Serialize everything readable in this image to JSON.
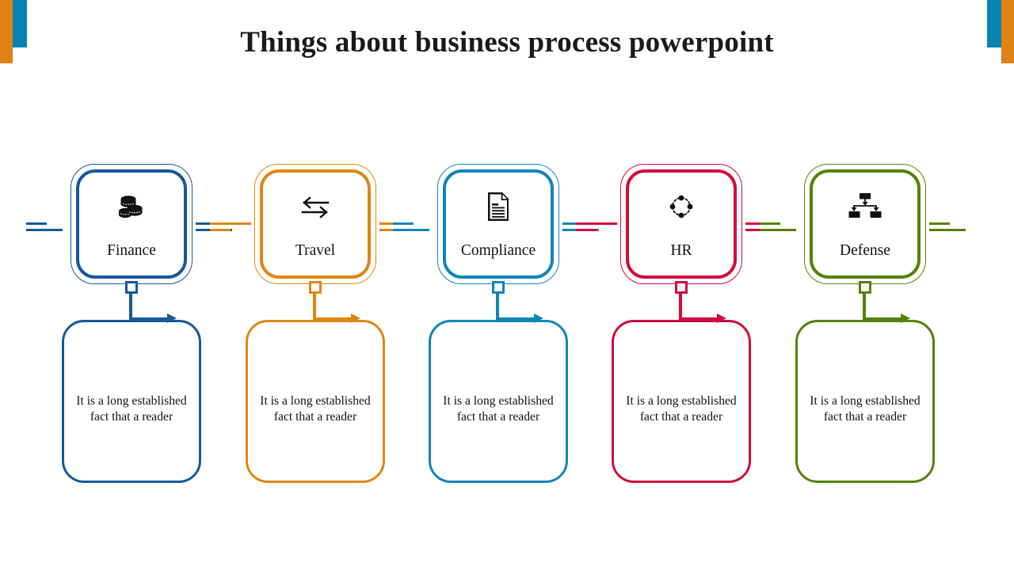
{
  "title": "Things about business process powerpoint",
  "decor": {
    "top_left_outer_color": "#DF8114",
    "top_left_inner_color": "#0682B4",
    "top_right_inner_color": "#0682B4",
    "top_right_outer_color": "#DF8114"
  },
  "columns": [
    {
      "label": "Finance",
      "icon": "coins-icon",
      "color": "#14599B",
      "body_text": "It is a long established fact that a reader"
    },
    {
      "label": "Travel",
      "icon": "exchange-arrows-icon",
      "color": "#E08711",
      "body_text": "It is a long established fact that a reader"
    },
    {
      "label": "Compliance",
      "icon": "document-icon",
      "color": "#1185B8",
      "body_text": "It is a long established fact that a reader"
    },
    {
      "label": "HR",
      "icon": "network-circle-icon",
      "color": "#D10B3F",
      "body_text": "It is a long established fact that a reader"
    },
    {
      "label": "Defense",
      "icon": "hierarchy-icon",
      "color": "#548208",
      "body_text": "It is a long established fact that a reader"
    }
  ]
}
